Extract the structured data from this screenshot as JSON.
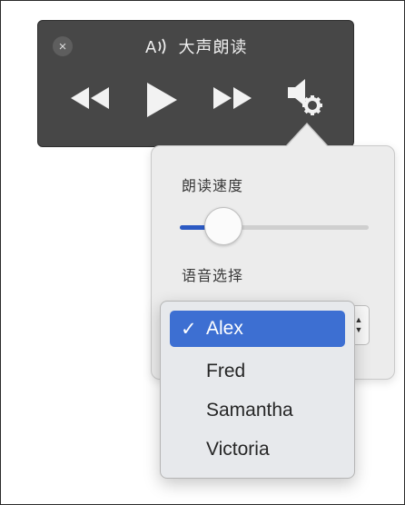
{
  "window": {
    "title": "大声朗读",
    "close_icon": "×",
    "icons": {
      "speak": "speak-aloud-icon",
      "rewind": "rewind-icon",
      "play": "play-icon",
      "fast_forward": "fast-forward-icon",
      "voice_settings": "speaker-gear-icon"
    }
  },
  "settings": {
    "speed_label": "朗读速度",
    "speed_value": 0.23,
    "voice_label": "语音选择"
  },
  "voice_menu": {
    "checkmark": "✓",
    "items": [
      {
        "label": "Alex",
        "selected": true
      },
      {
        "label": "Fred",
        "selected": false
      },
      {
        "label": "Samantha",
        "selected": false
      },
      {
        "label": "Victoria",
        "selected": false
      }
    ]
  },
  "colors": {
    "bar_bg": "#474747",
    "accent": "#3d6fd2",
    "slider_fill": "#2b59c3",
    "popover_bg": "#ececec"
  }
}
